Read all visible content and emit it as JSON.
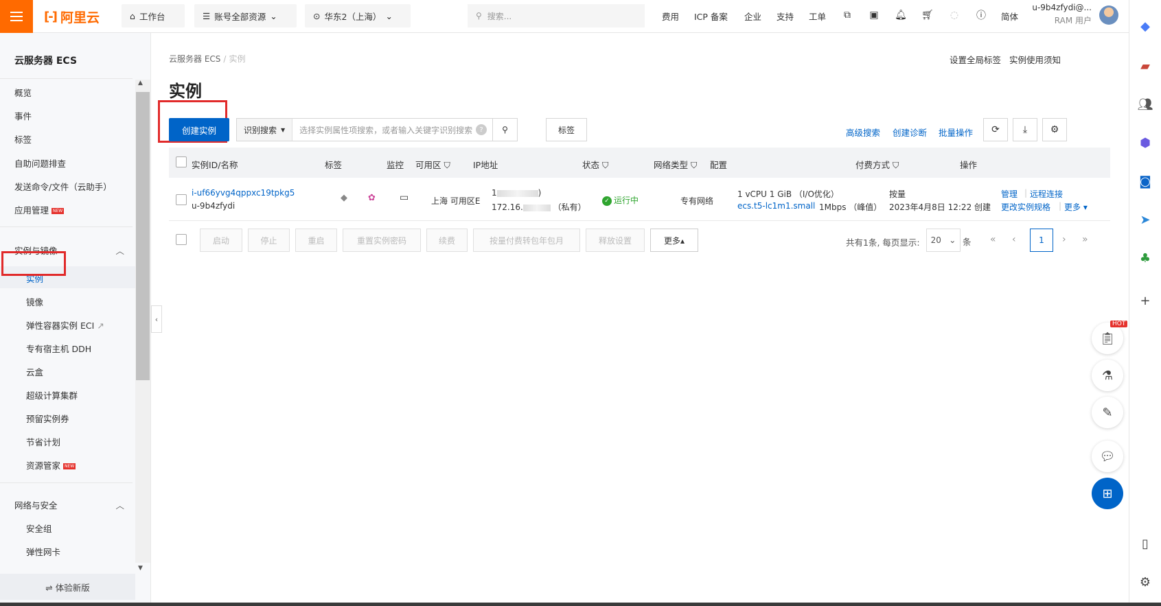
{
  "topbar": {
    "logo_text": "阿里云",
    "workbench": "工作台",
    "resources": "账号全部资源",
    "region": "华东2（上海）",
    "search_placeholder": "搜索...",
    "links": [
      "费用",
      "ICP 备案",
      "企业",
      "支持",
      "工单"
    ],
    "lang": "简体",
    "user_name": "u-9b4zfydi@...",
    "user_role": "RAM 用户",
    "brand_color": "#ff6a00"
  },
  "sidebar": {
    "title": "云服务器 ECS",
    "top_items": [
      "概览",
      "事件",
      "标签",
      "自助问题排查",
      "发送命令/文件（云助手）",
      "应用管理"
    ],
    "group1": {
      "label": "实例与镜像",
      "items": [
        "实例",
        "镜像",
        "弹性容器实例 ECI",
        "专有宿主机 DDH",
        "云盒",
        "超级计算集群",
        "预留实例券",
        "节省计划",
        "资源管家"
      ]
    },
    "group2": {
      "label": "网络与安全",
      "items": [
        "安全组",
        "弹性网卡"
      ]
    },
    "new_badge": "NEW",
    "bottom": "⇌ 体验新版"
  },
  "main": {
    "breadcrumb": [
      "云服务器 ECS",
      "实例"
    ],
    "header_links": [
      "设置全局标签",
      "实例使用须知"
    ],
    "title": "实例",
    "create_button": "创建实例",
    "search_type": "识别搜索",
    "search_placeholder": "选择实例属性项搜索，或者输入关键字识别搜索",
    "tag_button": "标签",
    "toolbar_links": [
      "高级搜索",
      "创建诊断",
      "批量操作"
    ],
    "accent_color": "#0064c8"
  },
  "table": {
    "columns": [
      "实例ID/名称",
      "标签",
      "监控",
      "可用区",
      "IP地址",
      "状态",
      "网络类型",
      "配置",
      "付费方式",
      "操作"
    ],
    "row": {
      "instance_id": "i-uf66yvg4qppxc19tpkg5",
      "instance_name": "u-9b4zfydi",
      "zone": "上海 可用区E",
      "ip_public_prefix": "1",
      "ip_public_suffix": ")",
      "ip_private_prefix": "172.16.",
      "ip_private_suffix": "（私有）",
      "status": "运行中",
      "network": "专有网络",
      "config_line1": "1 vCPU 1 GiB （I/O优化）",
      "config_spec": "ecs.t5-lc1m1.small",
      "config_bw": "1Mbps （峰值）",
      "billing": "按量",
      "created": "2023年4月8日 12:22 创建",
      "actions": [
        "管理",
        "远程连接",
        "更改实例规格",
        "更多"
      ]
    }
  },
  "batch": {
    "buttons": [
      "启动",
      "停止",
      "重启",
      "重置实例密码",
      "续费",
      "按量付费转包年包月",
      "释放设置"
    ],
    "more": "更多▴"
  },
  "pagination": {
    "total_text": "共有1条, 每页显示:",
    "page_size": "20",
    "unit": "条",
    "current_page": "1"
  },
  "float": {
    "hot": "HOT"
  }
}
